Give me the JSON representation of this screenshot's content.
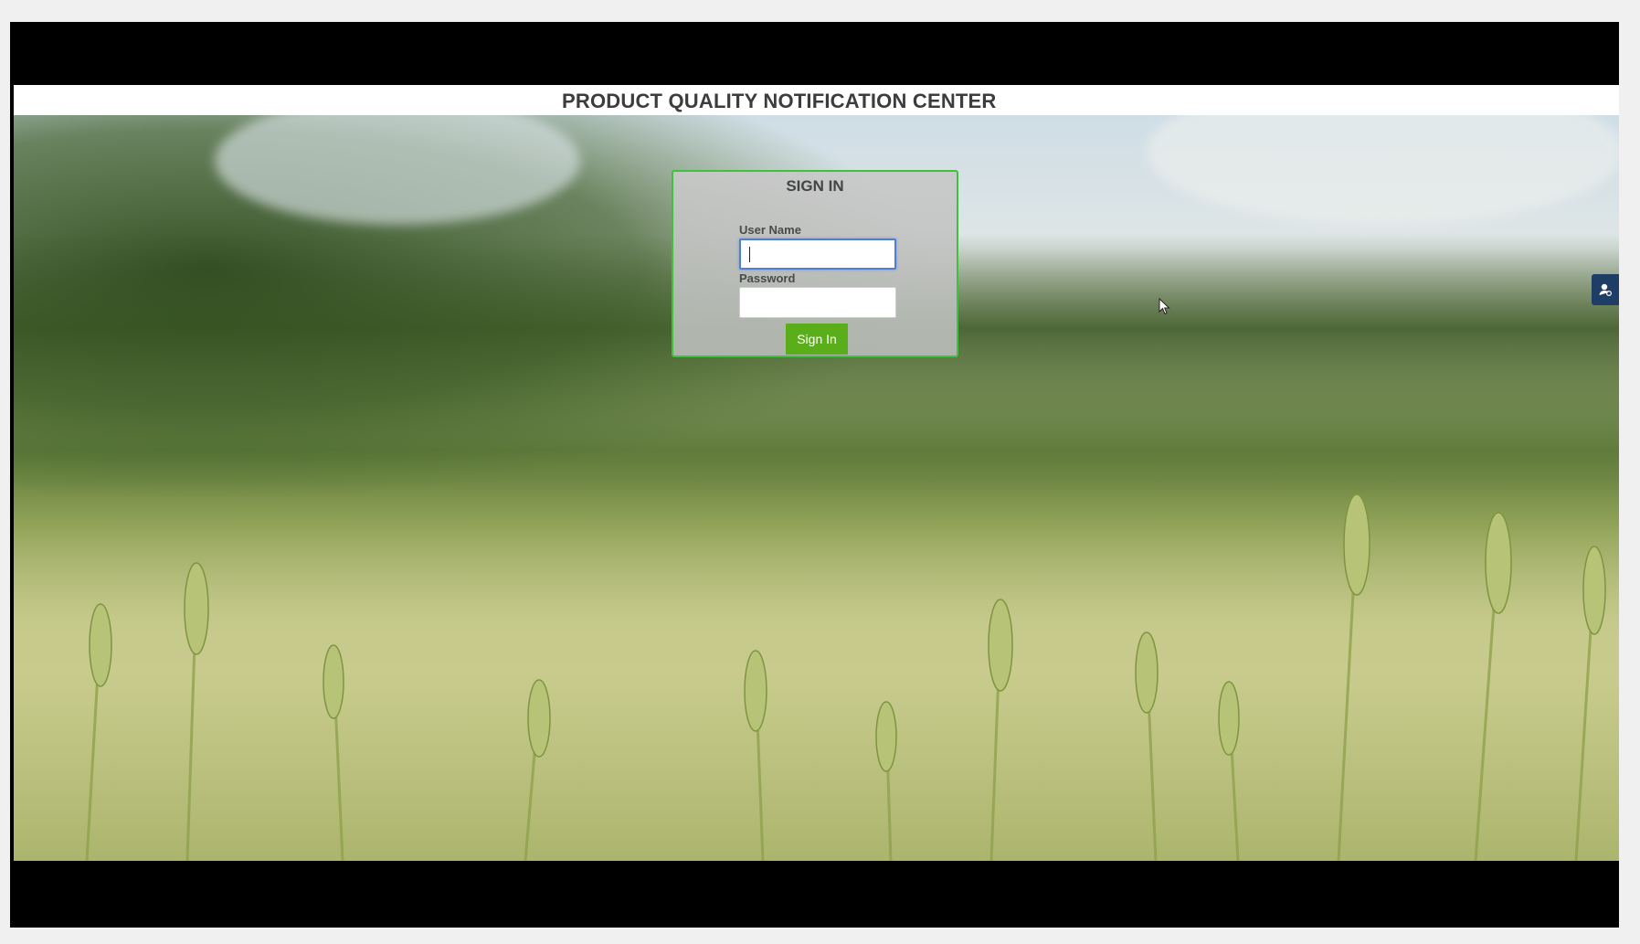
{
  "header": {
    "title": "PRODUCT QUALITY NOTIFICATION CENTER"
  },
  "signin": {
    "title": "SIGN IN",
    "username_label": "User Name",
    "username_value": "",
    "password_label": "Password",
    "password_value": "",
    "button_label": "Sign In"
  },
  "side_tab": {
    "icon": "user-support-icon"
  },
  "colors": {
    "panel_border": "#3ec23e",
    "button_bg": "#5aae1a",
    "focus_border": "#4d7fd6",
    "side_tab_bg": "#1f3e66"
  }
}
